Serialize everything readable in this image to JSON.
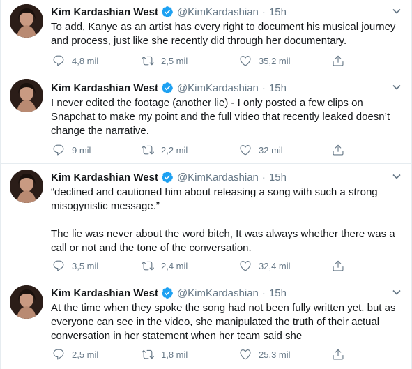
{
  "colors": {
    "text": "#14171a",
    "secondary": "#657786",
    "verified": "#1da1f2",
    "divider": "#e6ecf0"
  },
  "tweets": [
    {
      "name": "Kim Kardashian West",
      "handle": "@KimKardashian",
      "dot": "·",
      "time": "15h",
      "text": "To add, Kanye as an artist has every right to document his musical journey and process, just like she recently did through her documentary.",
      "replies": "4,8 mil",
      "retweets": "2,5 mil",
      "likes": "35,2 mil"
    },
    {
      "name": "Kim Kardashian West",
      "handle": "@KimKardashian",
      "dot": "·",
      "time": "15h",
      "text": "I never edited the footage (another lie) - I only posted a few clips on Snapchat to make my point and the full video that recently leaked doesn’t change the narrative.",
      "replies": "9 mil",
      "retweets": "2,2 mil",
      "likes": "32 mil"
    },
    {
      "name": "Kim Kardashian West",
      "handle": "@KimKardashian",
      "dot": "·",
      "time": "15h",
      "text": "“declined and cautioned him about releasing a song with such a strong misogynistic message.”\n\nThe lie was never about the word bitch, It was always whether there was a call or not and the tone of the conversation.",
      "replies": "3,5 mil",
      "retweets": "2,4 mil",
      "likes": "32,4 mil"
    },
    {
      "name": "Kim Kardashian West",
      "handle": "@KimKardashian",
      "dot": "·",
      "time": "15h",
      "text": "At the time when they spoke the song had not been fully written yet, but as everyone can see in the video, she manipulated the truth of their actual conversation in her statement when her team said she",
      "replies": "2,5 mil",
      "retweets": "1,8 mil",
      "likes": "25,3 mil"
    }
  ]
}
